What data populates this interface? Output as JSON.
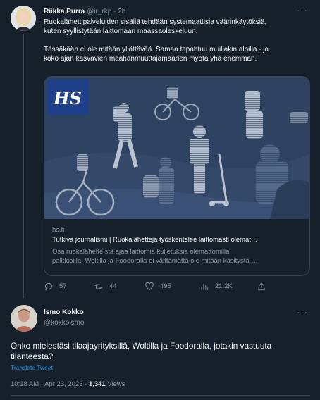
{
  "tweet1": {
    "author_name": "Riikka Purra",
    "author_handle": "@ir_rkp",
    "separator": "·",
    "time": "2h",
    "more_label": "···",
    "text_lines": [
      "Ruokalähettipalveluiden sisällä tehdään systemaattisia väärinkäytöksiä,",
      "kuten syyllistytään laittomaan maassaoleskeluun.",
      "Tässäkään ei ole mitään yllättävää. Samaa tapahtuu muillakin aloilla - ja",
      "koko ajan kasvavien maahanmuuttajamäärien myötä yhä enemmän."
    ],
    "card": {
      "logo": "HS",
      "domain": "hs.fi",
      "title": "Tutkiva journalismi | Ruokalähettejä työskentelee laittomasti olemat…",
      "description_lines": [
        "Osa ruokalähetteistä ajaa laittomia kuljetuksia olemattomilla",
        "palkkioilla. Woltilla ja Foodoralla ei välttämättä ole mitään käsitystä …"
      ]
    },
    "actions": {
      "replies": "57",
      "retweets": "44",
      "likes": "495",
      "views": "21.2K"
    }
  },
  "tweet2": {
    "author_name": "Ismo Kokko",
    "author_handle": "@kokkoismo",
    "more_label": "···",
    "text": "Onko mielestäsi tilaajayrityksillä, Woltilla ja Foodoralla, jotakin vastuuta tilanteesta?",
    "translate_label": "Translate Tweet",
    "time": "10:18 AM",
    "separator": "·",
    "date": "Apr 23, 2023",
    "views_count": "1,341",
    "views_label": "Views"
  },
  "colors": {
    "background": "#15202b",
    "text_primary": "#f7f9f9",
    "text_secondary": "#8b98a5",
    "link": "#1d9bf0",
    "border": "#38444d",
    "card_image_bg": "#2c3f5a",
    "logo_bg": "#1e3f8a"
  },
  "icons": {
    "reply": "reply-icon",
    "retweet": "retweet-icon",
    "like": "like-icon",
    "views": "views-icon",
    "share": "share-icon",
    "more": "more-icon"
  }
}
